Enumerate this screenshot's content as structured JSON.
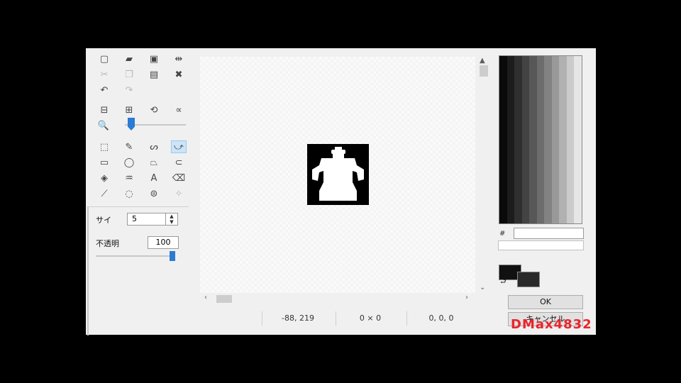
{
  "toolbar": {
    "file_tools": [
      {
        "icon": "new-file-icon",
        "glyph": "▢"
      },
      {
        "icon": "open-folder-icon",
        "glyph": "▰"
      },
      {
        "icon": "save-icon",
        "glyph": "▣"
      },
      {
        "icon": "resize-icon",
        "glyph": "⇹"
      }
    ],
    "edit_tools": [
      {
        "icon": "cut-icon",
        "glyph": "✂"
      },
      {
        "icon": "copy-icon",
        "glyph": "❐"
      },
      {
        "icon": "paste-icon",
        "glyph": "▤"
      },
      {
        "icon": "crop-icon",
        "glyph": "✖"
      }
    ],
    "history_tools": [
      {
        "icon": "undo-icon",
        "glyph": "↶"
      },
      {
        "icon": "redo-icon",
        "glyph": "↷"
      }
    ],
    "view_tools": [
      {
        "icon": "flip-horizontal-icon",
        "glyph": "⊟"
      },
      {
        "icon": "flip-vertical-icon",
        "glyph": "⊞"
      },
      {
        "icon": "rotate-icon",
        "glyph": "⟲"
      },
      {
        "icon": "invert-icon",
        "glyph": "∝"
      }
    ],
    "zoom_icon": "🔍",
    "draw_tools": [
      {
        "icon": "rect-select-icon",
        "glyph": "⬚"
      },
      {
        "icon": "pencil-icon",
        "glyph": "✎"
      },
      {
        "icon": "freehand-icon",
        "glyph": "ᔕ"
      },
      {
        "icon": "curve-icon",
        "glyph": "⤻"
      },
      {
        "icon": "rectangle-icon",
        "glyph": "▭"
      },
      {
        "icon": "ellipse-icon",
        "glyph": "◯"
      },
      {
        "icon": "polygon-icon",
        "glyph": "⏢"
      },
      {
        "icon": "lasso-icon",
        "glyph": "⊂"
      },
      {
        "icon": "fill-bucket-icon",
        "glyph": "◈"
      },
      {
        "icon": "color-replace-icon",
        "glyph": "♒"
      },
      {
        "icon": "text-icon",
        "glyph": "A"
      },
      {
        "icon": "eraser-icon",
        "glyph": "⌫"
      },
      {
        "icon": "line-icon",
        "glyph": "⟋"
      },
      {
        "icon": "lasso-select-icon",
        "glyph": "◌"
      },
      {
        "icon": "eyedropper-icon",
        "glyph": "⊜"
      },
      {
        "icon": "point-icon",
        "glyph": "✧"
      }
    ]
  },
  "properties": {
    "size_label": "サイ",
    "size_value": "5",
    "opacity_label": "不透明",
    "opacity_value": "100",
    "opacity_level": 1.0
  },
  "status": {
    "cursor": "-88, 219",
    "selection": "0 × 0",
    "color": "0, 0, 0"
  },
  "color_panel": {
    "hex_label": "#",
    "palette": [
      "#0a0a0a",
      "#1c1c1c",
      "#2f2f2f",
      "#434343",
      "#575757",
      "#6c6c6c",
      "#828282",
      "#999999",
      "#b1b1b1",
      "#cbcbcb",
      "#e6e6e6"
    ],
    "primary": "#111111",
    "secondary": "#2a2a2a"
  },
  "buttons": {
    "ok": "OK",
    "cancel": "キャンセル"
  },
  "watermark": "DMax4832"
}
